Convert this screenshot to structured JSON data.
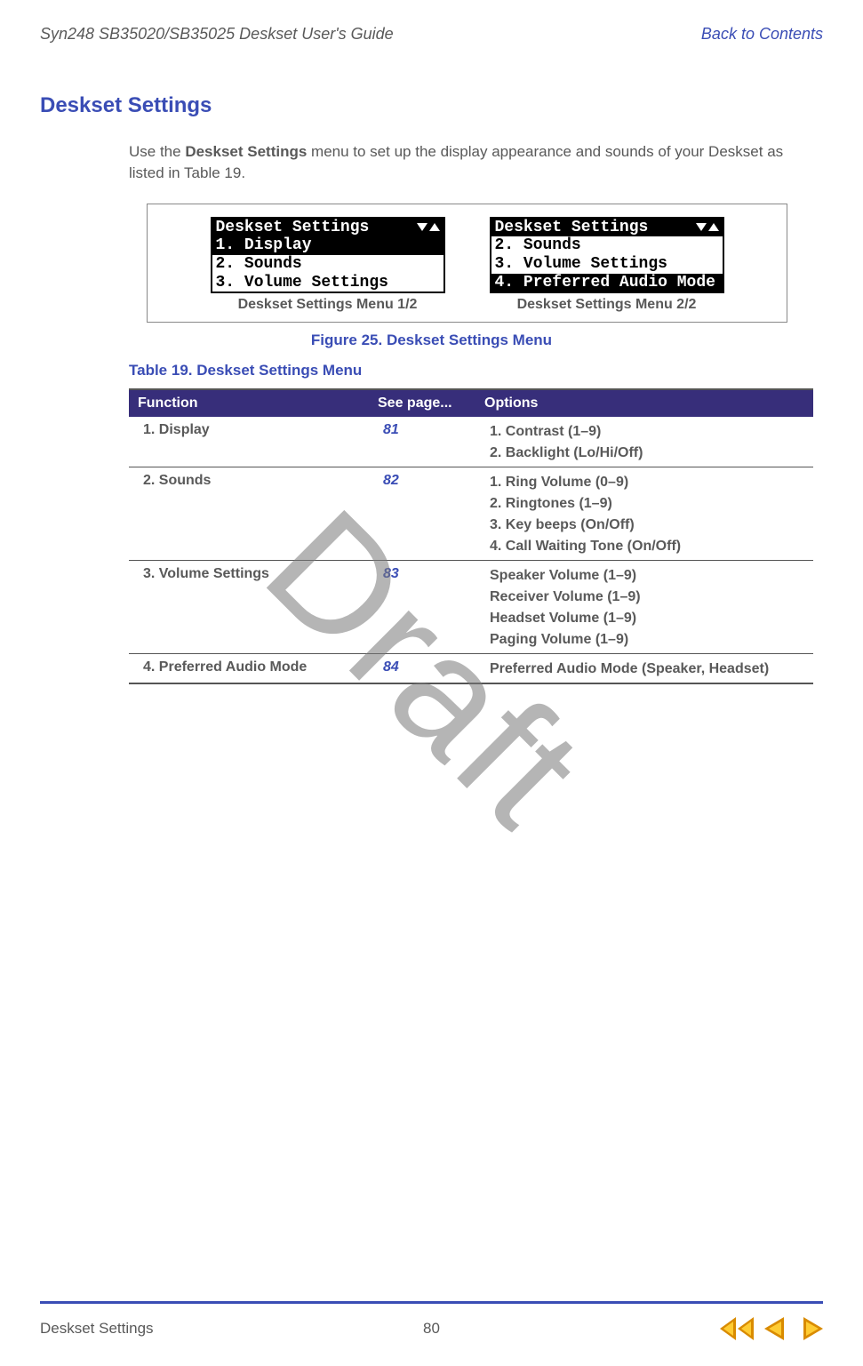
{
  "header": {
    "left": "Syn248 SB35020/SB35025 Deskset User's Guide",
    "right": "Back to Contents"
  },
  "h1": "Deskset Settings",
  "intro_prefix": "Use the ",
  "intro_bold": "Deskset Settings",
  "intro_suffix": " menu to set up the display appearance and sounds of your Deskset as listed in Table 19.",
  "figure": {
    "lcd1": {
      "title": "Deskset Settings",
      "rows": [
        "1. Display",
        "2. Sounds",
        "3. Volume Settings"
      ],
      "caption": "Deskset Settings Menu 1/2"
    },
    "lcd2": {
      "title": "Deskset Settings",
      "rows": [
        "2. Sounds",
        "3. Volume Settings",
        "4. Preferred Audio Mode"
      ],
      "caption": "Deskset Settings Menu 2/2"
    },
    "caption": "Figure 25.  Deskset Settings Menu"
  },
  "table_caption": "Table 19.   Deskset Settings Menu",
  "table": {
    "headers": [
      "Function",
      "See page...",
      "Options"
    ],
    "rows": [
      {
        "function": "1. Display",
        "page": "81",
        "options": [
          "1. Contrast (1–9)",
          "2. Backlight (Lo/Hi/Off)"
        ]
      },
      {
        "function": "2. Sounds",
        "page": "82",
        "options": [
          "1. Ring Volume (0–9)",
          "2. Ringtones (1–9)",
          "3. Key beeps (On/Off)",
          "4. Call Waiting Tone (On/Off)"
        ]
      },
      {
        "function": "3. Volume Settings",
        "page": "83",
        "options": [
          "Speaker Volume (1–9)",
          "Receiver Volume (1–9)",
          "Headset Volume (1–9)",
          "Paging Volume (1–9)"
        ]
      },
      {
        "function": "4. Preferred Audio Mode",
        "page": "84",
        "options": [
          "Preferred Audio Mode (Speaker, Headset)"
        ]
      }
    ]
  },
  "watermark": "Draft",
  "footer": {
    "section": "Deskset Settings",
    "page": "80"
  }
}
